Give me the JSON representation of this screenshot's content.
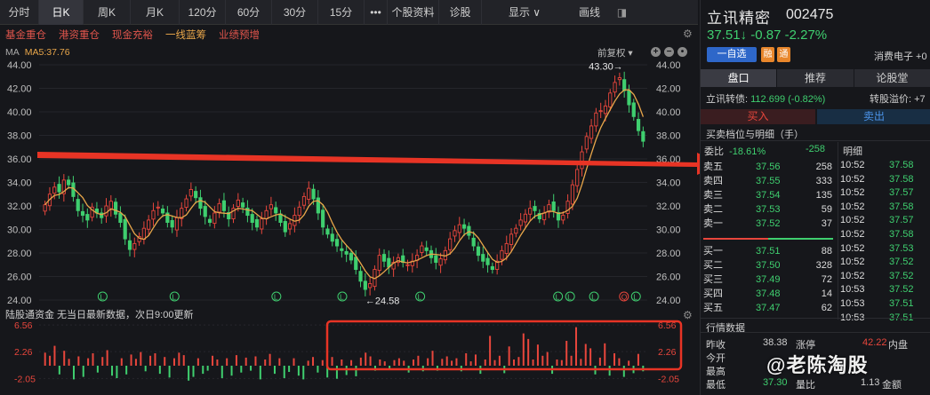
{
  "tabs": [
    {
      "label": "分时"
    },
    {
      "label": "日K"
    },
    {
      "label": "周K"
    },
    {
      "label": "月K"
    },
    {
      "label": "120分"
    },
    {
      "label": "60分"
    },
    {
      "label": "30分"
    },
    {
      "label": "15分"
    },
    {
      "label": "•••"
    },
    {
      "label": "个股资料"
    },
    {
      "label": "诊股"
    },
    {
      "label": "显示 ∨"
    },
    {
      "label": "画线"
    }
  ],
  "filters": [
    "基金重仓",
    "港资重仓",
    "现金充裕",
    "一线蓝筹",
    "业绩预增"
  ],
  "ma": {
    "label": "MA",
    "value": "MA5:37.76"
  },
  "adjust": "前复权 ▾",
  "price_axis": [
    "44.00",
    "42.00",
    "40.00",
    "38.00",
    "36.00",
    "34.00",
    "32.00",
    "30.00",
    "28.00",
    "26.00",
    "24.00"
  ],
  "price_axis_right": [
    "44.00",
    "42.00",
    "40.00",
    "38.00",
    "36.00",
    "34.00",
    "32.00",
    "30.00",
    "28.00",
    "26.00",
    "24.00"
  ],
  "annotations": {
    "high": "43.30→",
    "low": "←24.58"
  },
  "fund": {
    "title": "陆股通资金  无当日最新数据，次日9:00更新",
    "axis": [
      "6.56",
      "2.26",
      "-2.05"
    ]
  },
  "stock": {
    "name": "立讯精密",
    "code": "002475",
    "price": "37.51↓",
    "change": "-0.87",
    "pct": "-2.27%",
    "select_label": "一自选",
    "badge1": "融",
    "badge2": "通",
    "industry": "消费电子 +0"
  },
  "right_tabs": [
    "盘口",
    "推荐",
    "论股堂"
  ],
  "convertible": {
    "label": "立讯转债:",
    "value": "112.699 (-0.82%)",
    "premium": "转股溢价: +7"
  },
  "buy_label": "买入",
  "sell_label": "卖出",
  "section": "买卖档位与明细（手）",
  "weibi": {
    "label": "委比",
    "pct": "-18.61%",
    "diff": "-258",
    "detail": "明细"
  },
  "asks": [
    {
      "label": "卖五",
      "price": "37.56",
      "vol": "258"
    },
    {
      "label": "卖四",
      "price": "37.55",
      "vol": "333"
    },
    {
      "label": "卖三",
      "price": "37.54",
      "vol": "135"
    },
    {
      "label": "卖二",
      "price": "37.53",
      "vol": "59"
    },
    {
      "label": "卖一",
      "price": "37.52",
      "vol": "37"
    }
  ],
  "bids": [
    {
      "label": "买一",
      "price": "37.51",
      "vol": "88"
    },
    {
      "label": "买二",
      "price": "37.50",
      "vol": "328"
    },
    {
      "label": "买三",
      "price": "37.49",
      "vol": "72"
    },
    {
      "label": "买四",
      "price": "37.48",
      "vol": "14"
    },
    {
      "label": "买五",
      "price": "37.47",
      "vol": "62"
    }
  ],
  "ticks": [
    {
      "t": "10:52",
      "p": "37.58"
    },
    {
      "t": "10:52",
      "p": "37.58"
    },
    {
      "t": "10:52",
      "p": "37.57"
    },
    {
      "t": "10:52",
      "p": "37.58"
    },
    {
      "t": "10:52",
      "p": "37.57"
    },
    {
      "t": "10:52",
      "p": "37.58"
    },
    {
      "t": "10:52",
      "p": "37.53"
    },
    {
      "t": "10:52",
      "p": "37.52"
    },
    {
      "t": "10:52",
      "p": "37.52"
    },
    {
      "t": "10:53",
      "p": "37.52"
    },
    {
      "t": "10:53",
      "p": "37.51"
    },
    {
      "t": "10:53",
      "p": "37.51"
    }
  ],
  "quote_title": "行情数据",
  "quote": {
    "zs_l": "昨收",
    "zs_v": "38.38",
    "zt_l": "涨停",
    "zt_v": "42.22",
    "np_l": "内盘",
    "jk_l": "今开",
    "zg_l": "最高",
    "zd_l": "最低",
    "zd_v": "37.30",
    "lb_l": "量比",
    "lb_v": "1.13",
    "je_l": "金额"
  },
  "watermark": "@老陈淘股",
  "colors": {
    "up": "#e8463c",
    "down": "#3fcf6f",
    "ma": "#e8a64a",
    "accent": "#e83425",
    "select": "#2e67c9"
  },
  "chart_data": {
    "type": "candlestick",
    "ylim": [
      24,
      44
    ],
    "y_ticks": [
      44,
      42,
      40,
      38,
      36,
      34,
      32,
      30,
      28,
      26,
      24
    ],
    "ma5_last": 37.76,
    "high_label_value": 43.3,
    "low_label_value": 24.58,
    "closes": [
      32.1,
      33.0,
      33.6,
      33.2,
      34.2,
      33.8,
      32.8,
      31.6,
      31.2,
      30.8,
      31.9,
      31.4,
      31.0,
      32.0,
      32.4,
      31.3,
      30.6,
      29.2,
      28.3,
      28.8,
      29.4,
      30.1,
      30.8,
      31.6,
      31.9,
      31.4,
      30.6,
      30.2,
      31.0,
      31.8,
      32.6,
      33.4,
      32.7,
      31.8,
      31.1,
      30.6,
      31.4,
      32.2,
      31.6,
      30.9,
      31.8,
      32.5,
      31.9,
      31.2,
      30.6,
      30.2,
      30.9,
      31.6,
      32.1,
      31.4,
      30.6,
      29.8,
      30.5,
      31.2,
      31.9,
      32.8,
      33.5,
      32.6,
      31.4,
      30.2,
      29.6,
      29.0,
      28.6,
      28.2,
      27.9,
      27.4,
      26.6,
      25.6,
      24.9,
      25.4,
      26.6,
      27.8,
      27.3,
      26.8,
      27.2,
      27.6,
      27.2,
      27.0,
      27.3,
      27.8,
      28.6,
      28.2,
      27.6,
      27.2,
      27.5,
      28.2,
      29.2,
      29.9,
      30.4,
      30.1,
      29.5,
      28.6,
      27.8,
      27.3,
      27.0,
      26.6,
      27.3,
      28.2,
      28.8,
      29.6,
      30.1,
      30.8,
      31.3,
      31.8,
      31.6,
      30.9,
      31.4,
      32.1,
      31.6,
      30.8,
      31.2,
      32.4,
      33.8,
      35.1,
      36.6,
      37.9,
      38.8,
      39.9,
      40.1,
      40.5,
      41.6,
      42.5,
      42.9,
      41.8,
      40.6,
      39.6,
      38.4,
      37.5
    ],
    "volumes": [
      2.1,
      1.6,
      3.2,
      -1.4,
      2.4,
      1.1,
      -2.2,
      1.5,
      -1.8,
      1.2,
      2.0,
      -1.1,
      1.4,
      2.5,
      -1.6,
      -2.0,
      1.2,
      -1.4,
      1.8,
      1.1,
      2.2,
      -0.9,
      1.6,
      2.0,
      -1.3,
      1.4,
      -1.9,
      1.2,
      2.1,
      1.7,
      -2.4,
      -1.8,
      1.2,
      -1.3,
      -0.8,
      1.6,
      1.0,
      -2.0,
      1.2,
      -1.6,
      1.7,
      -1.1,
      1.3,
      -0.8,
      1.5,
      -2.2,
      1.0,
      1.9,
      -1.3,
      1.2,
      -2.0,
      -1.0,
      1.2,
      -1.6,
      -2.2,
      0.8,
      1.4,
      -1.1,
      0.9,
      -1.9,
      1.4,
      -2.1,
      1.0,
      -1.5,
      0.9,
      -1.7,
      1.3,
      2.1,
      1.5,
      -0.8,
      1.0,
      0.7,
      -0.6,
      0.9,
      1.2,
      0.8,
      -1.1,
      1.0,
      1.6,
      -0.9,
      1.2,
      2.4,
      -0.8,
      1.1,
      1.5,
      0.8,
      1.2,
      -0.9,
      2.0,
      0.7,
      1.8,
      -1.3,
      1.0,
      4.8,
      0.9,
      1.6,
      -1.2,
      3.1,
      1.0,
      1.4,
      5.2,
      4.3,
      1.0,
      3.4,
      1.6,
      2.2,
      -1.3,
      1.0,
      0.9,
      4.0,
      1.6,
      6.2,
      1.1,
      3.5,
      2.8,
      -1.4,
      1.3,
      3.6,
      -1.6,
      2.0,
      1.2,
      -1.8,
      0.8,
      -1.2,
      1.9,
      -0.9
    ]
  }
}
